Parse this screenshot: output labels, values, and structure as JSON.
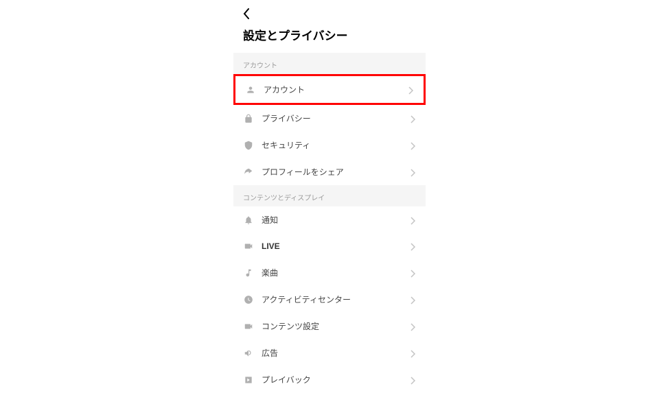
{
  "header": {
    "title": "設定とプライバシー"
  },
  "sections": [
    {
      "header": "アカウント",
      "items": [
        {
          "icon": "person",
          "label": "アカウント",
          "highlighted": true
        },
        {
          "icon": "lock",
          "label": "プライバシー"
        },
        {
          "icon": "shield",
          "label": "セキュリティ"
        },
        {
          "icon": "share",
          "label": "プロフィールをシェア"
        }
      ]
    },
    {
      "header": "コンテンツとディスプレイ",
      "items": [
        {
          "icon": "bell",
          "label": "通知"
        },
        {
          "icon": "video",
          "label": "LIVE",
          "bold": true
        },
        {
          "icon": "music",
          "label": "楽曲"
        },
        {
          "icon": "clock",
          "label": "アクティビティセンター"
        },
        {
          "icon": "camera",
          "label": "コンテンツ設定"
        },
        {
          "icon": "megaphone",
          "label": "広告"
        },
        {
          "icon": "play",
          "label": "プレイバック"
        }
      ]
    }
  ]
}
